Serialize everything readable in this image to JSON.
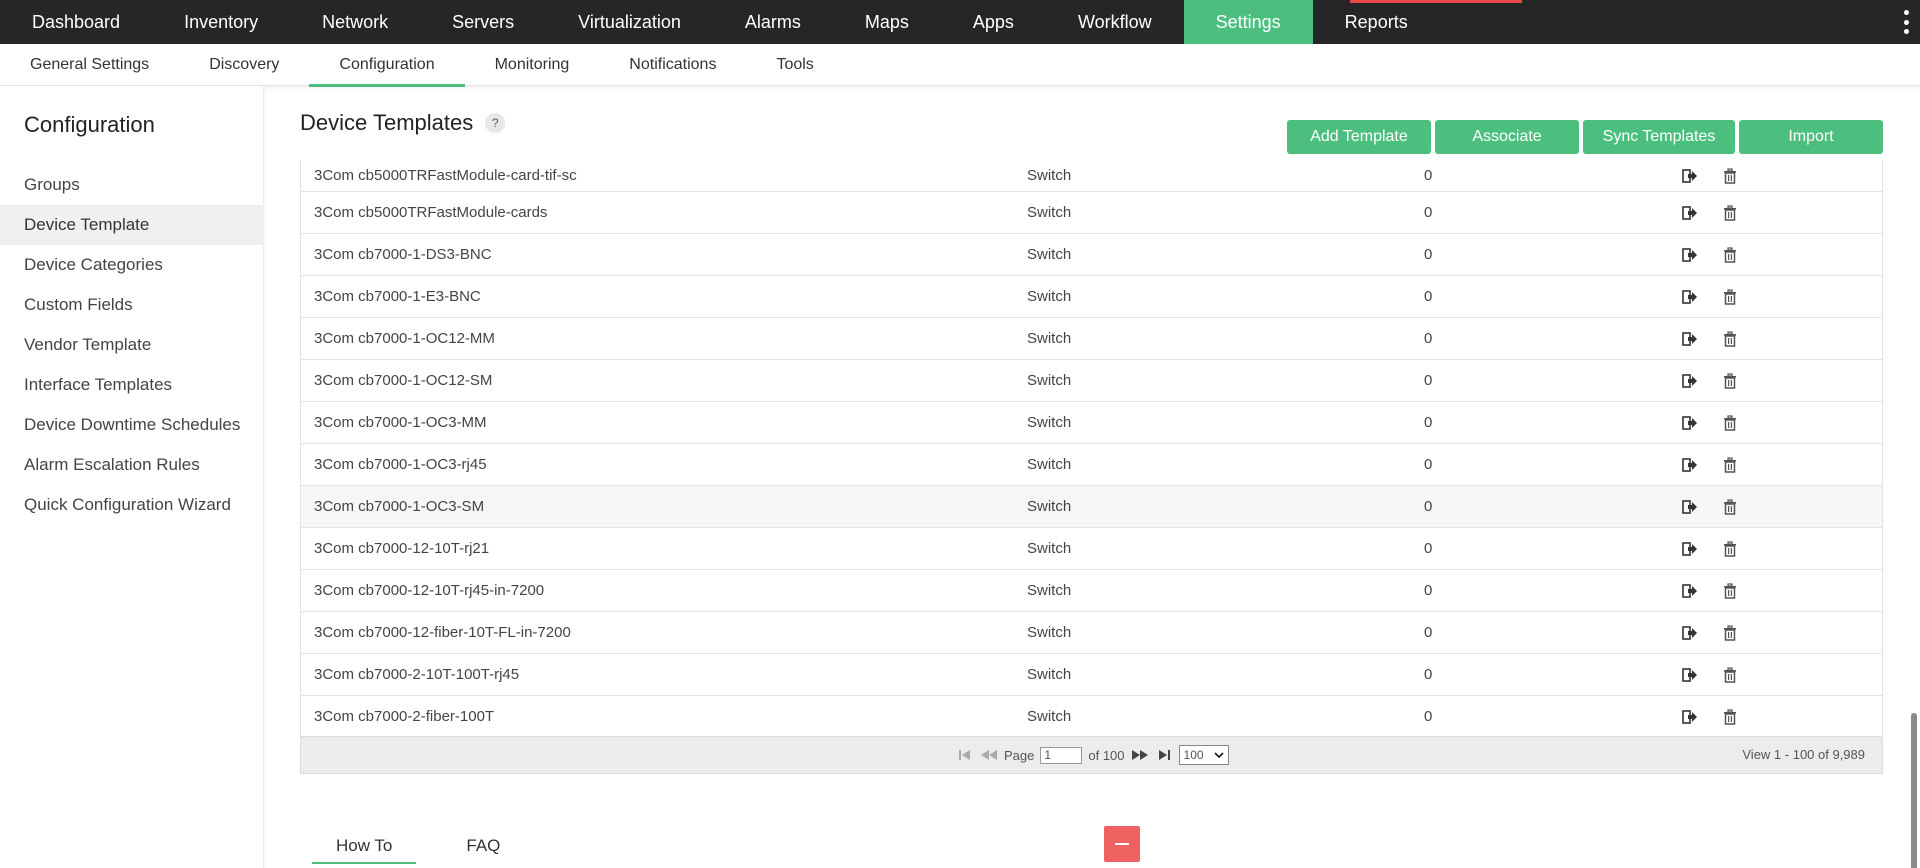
{
  "topnav": {
    "items": [
      {
        "label": "Dashboard",
        "active": false
      },
      {
        "label": "Inventory",
        "active": false
      },
      {
        "label": "Network",
        "active": false
      },
      {
        "label": "Servers",
        "active": false
      },
      {
        "label": "Virtualization",
        "active": false
      },
      {
        "label": "Alarms",
        "active": false
      },
      {
        "label": "Maps",
        "active": false
      },
      {
        "label": "Apps",
        "active": false
      },
      {
        "label": "Workflow",
        "active": false
      },
      {
        "label": "Settings",
        "active": true
      },
      {
        "label": "Reports",
        "active": false
      }
    ],
    "menu_icon": "vertical-ellipsis-icon"
  },
  "subnav": {
    "items": [
      {
        "label": "General Settings",
        "active": false
      },
      {
        "label": "Discovery",
        "active": false
      },
      {
        "label": "Configuration",
        "active": true
      },
      {
        "label": "Monitoring",
        "active": false
      },
      {
        "label": "Notifications",
        "active": false
      },
      {
        "label": "Tools",
        "active": false
      }
    ]
  },
  "sidebar": {
    "title": "Configuration",
    "items": [
      {
        "label": "Groups",
        "active": false
      },
      {
        "label": "Device Template",
        "active": true
      },
      {
        "label": "Device Categories",
        "active": false
      },
      {
        "label": "Custom Fields",
        "active": false
      },
      {
        "label": "Vendor Template",
        "active": false
      },
      {
        "label": "Interface Templates",
        "active": false
      },
      {
        "label": "Device Downtime Schedules",
        "active": false
      },
      {
        "label": "Alarm Escalation Rules",
        "active": false
      },
      {
        "label": "Quick Configuration Wizard",
        "active": false
      }
    ]
  },
  "page": {
    "title": "Device Templates",
    "help_label": "?"
  },
  "actions": {
    "add": "Add Template",
    "associate": "Associate",
    "sync": "Sync Templates",
    "import": "Import"
  },
  "table": {
    "rows": [
      {
        "name": "3Com cb5000TRFastModule-card-tif-sc",
        "category": "Switch",
        "count": "0"
      },
      {
        "name": "3Com cb5000TRFastModule-cards",
        "category": "Switch",
        "count": "0"
      },
      {
        "name": "3Com cb7000-1-DS3-BNC",
        "category": "Switch",
        "count": "0"
      },
      {
        "name": "3Com cb7000-1-E3-BNC",
        "category": "Switch",
        "count": "0"
      },
      {
        "name": "3Com cb7000-1-OC12-MM",
        "category": "Switch",
        "count": "0"
      },
      {
        "name": "3Com cb7000-1-OC12-SM",
        "category": "Switch",
        "count": "0"
      },
      {
        "name": "3Com cb7000-1-OC3-MM",
        "category": "Switch",
        "count": "0"
      },
      {
        "name": "3Com cb7000-1-OC3-rj45",
        "category": "Switch",
        "count": "0"
      },
      {
        "name": "3Com cb7000-1-OC3-SM",
        "category": "Switch",
        "count": "0"
      },
      {
        "name": "3Com cb7000-12-10T-rj21",
        "category": "Switch",
        "count": "0"
      },
      {
        "name": "3Com cb7000-12-10T-rj45-in-7200",
        "category": "Switch",
        "count": "0"
      },
      {
        "name": "3Com cb7000-12-fiber-10T-FL-in-7200",
        "category": "Switch",
        "count": "0"
      },
      {
        "name": "3Com cb7000-2-10T-100T-rj45",
        "category": "Switch",
        "count": "0"
      },
      {
        "name": "3Com cb7000-2-fiber-100T",
        "category": "Switch",
        "count": "0"
      }
    ],
    "highlighted_row": 8,
    "action_icons": [
      "export-icon",
      "trash-icon"
    ]
  },
  "pager": {
    "page_label": "Page",
    "page_value": "1",
    "of_label": "of 100",
    "per_page": "100",
    "view_text": "View 1 - 100 of 9,989"
  },
  "bottom_tabs": [
    {
      "label": "How To",
      "active": true
    },
    {
      "label": "FAQ",
      "active": false
    }
  ],
  "colors": {
    "accent": "#4cbf7e",
    "topbar": "#262626",
    "danger": "#f06262"
  }
}
